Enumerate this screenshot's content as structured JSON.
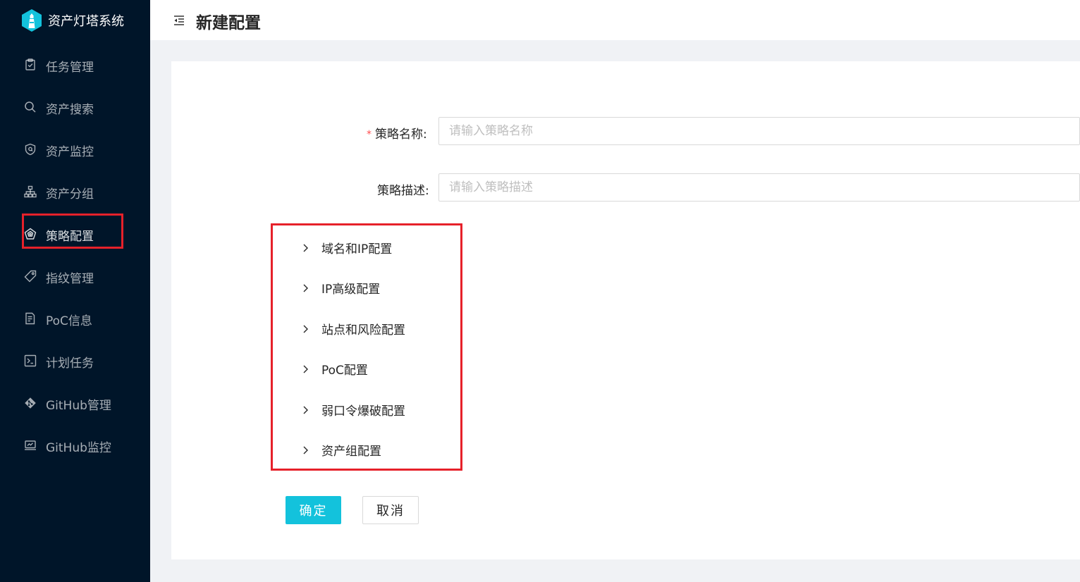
{
  "app": {
    "title": "资产灯塔系统"
  },
  "sidebar": {
    "items": [
      {
        "label": "任务管理",
        "icon": "task-icon"
      },
      {
        "label": "资产搜索",
        "icon": "search-icon"
      },
      {
        "label": "资产监控",
        "icon": "shield-icon"
      },
      {
        "label": "资产分组",
        "icon": "sitemap-icon"
      },
      {
        "label": "策略配置",
        "icon": "strategy-icon",
        "active": true
      },
      {
        "label": "指纹管理",
        "icon": "tag-icon"
      },
      {
        "label": "PoC信息",
        "icon": "document-icon"
      },
      {
        "label": "计划任务",
        "icon": "terminal-icon"
      },
      {
        "label": "GitHub管理",
        "icon": "git-icon"
      },
      {
        "label": "GitHub监控",
        "icon": "monitor-icon"
      }
    ]
  },
  "header": {
    "title": "新建配置"
  },
  "form": {
    "name_label": "策略名称:",
    "name_placeholder": "请输入策略名称",
    "desc_label": "策略描述:",
    "desc_placeholder": "请输入策略描述",
    "panels": [
      "域名和IP配置",
      "IP高级配置",
      "站点和风险配置",
      "PoC配置",
      "弱口令爆破配置",
      "资产组配置"
    ],
    "confirm_label": "确定",
    "cancel_label": "取消"
  },
  "colors": {
    "sidebar_bg": "#001529",
    "primary": "#13c2dc",
    "highlight": "#e6212a"
  }
}
